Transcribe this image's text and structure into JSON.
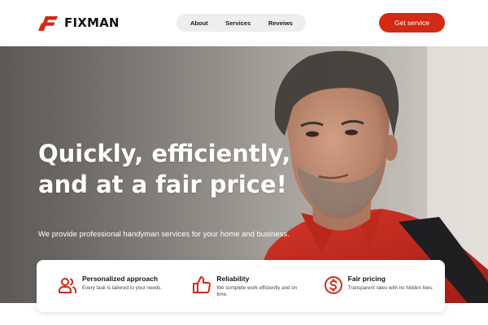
{
  "brand": {
    "name": "FIXMAN",
    "accent_color": "#d22a14",
    "logo_icon": "f-logo-icon"
  },
  "nav": {
    "items": [
      "About",
      "Services",
      "Reveiws"
    ]
  },
  "cta": {
    "label": "Get service"
  },
  "hero": {
    "title": "Quickly, efficiently, and at a fair price!",
    "subtitle": "We provide professional handyman services for your home and business.",
    "image_subject": "handyman-portrait"
  },
  "features": [
    {
      "icon": "users-icon",
      "title": "Personalized approach",
      "desc": "Every task is tailored to your needs."
    },
    {
      "icon": "thumbs-up-icon",
      "title": "Reliability",
      "desc": "We complete work efficiently and on time."
    },
    {
      "icon": "dollar-circle-icon",
      "title": "Fair pricing",
      "desc": "Transparent rates with no hidden fees."
    }
  ]
}
